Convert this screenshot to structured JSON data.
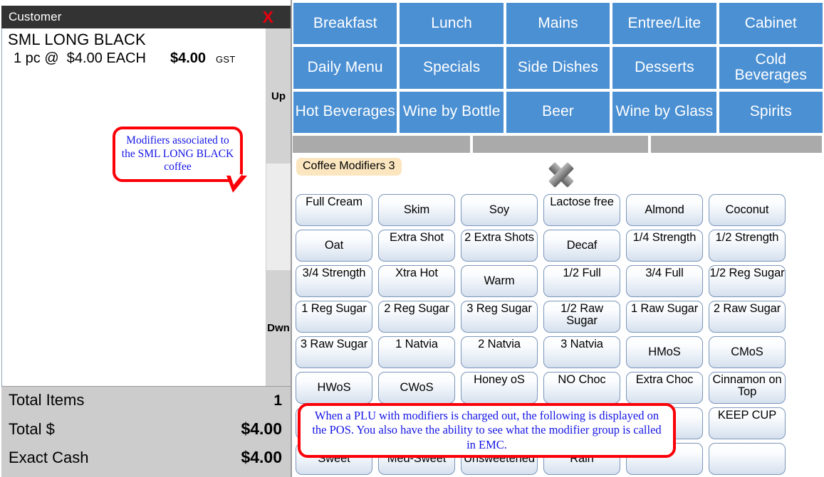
{
  "receipt": {
    "title": "Customer",
    "close_label": "X",
    "line_item": {
      "name": "SML LONG BLACK",
      "qty_text": "1 pc @  $4.00 EACH",
      "amount": "$4.00",
      "tax_code": "GST"
    },
    "scroll": {
      "up_label": "Up",
      "down_label": "Dwn"
    },
    "totals": [
      {
        "label": "Total Items",
        "value": "1"
      },
      {
        "label": "Total $",
        "value": "$4.00"
      },
      {
        "label": "Exact Cash",
        "value": "$4.00"
      }
    ]
  },
  "categories": [
    {
      "label": "Breakfast"
    },
    {
      "label": "Lunch"
    },
    {
      "label": "Mains"
    },
    {
      "label": "Entree/Lite"
    },
    {
      "label": "Cabinet"
    },
    {
      "label": "Daily Menu"
    },
    {
      "label": "Specials"
    },
    {
      "label": "Side Dishes"
    },
    {
      "label": "Desserts"
    },
    {
      "label": "Cold Beverages"
    },
    {
      "label": "Hot Beverages"
    },
    {
      "label": "Wine by Bottle"
    },
    {
      "label": "Beer"
    },
    {
      "label": "Wine by Glass"
    },
    {
      "label": "Spirits"
    }
  ],
  "modifier_group": {
    "tab_label": "Coffee Modifiers 3",
    "close_icon": "close-x-icon"
  },
  "modifiers": [
    {
      "label": "Full Cream"
    },
    {
      "label": "Skim"
    },
    {
      "label": "Soy"
    },
    {
      "label": "Lactose free"
    },
    {
      "label": "Almond"
    },
    {
      "label": "Coconut"
    },
    {
      "label": "Oat"
    },
    {
      "label": "Extra Shot"
    },
    {
      "label": "2 Extra Shots"
    },
    {
      "label": "Decaf"
    },
    {
      "label": "1/4 Strength"
    },
    {
      "label": "1/2 Strength"
    },
    {
      "label": "3/4 Strength"
    },
    {
      "label": "Xtra Hot"
    },
    {
      "label": "Warm"
    },
    {
      "label": "1/2 Full"
    },
    {
      "label": "3/4 Full"
    },
    {
      "label": "1/2 Reg Sugar"
    },
    {
      "label": "1 Reg Sugar"
    },
    {
      "label": "2 Reg Sugar"
    },
    {
      "label": "3 Reg Sugar"
    },
    {
      "label": "1/2 Raw Sugar"
    },
    {
      "label": "1 Raw Sugar"
    },
    {
      "label": "2 Raw Sugar"
    },
    {
      "label": "3 Raw Sugar"
    },
    {
      "label": "1 Natvia"
    },
    {
      "label": "2 Natvia"
    },
    {
      "label": "3 Natvia"
    },
    {
      "label": "HMoS"
    },
    {
      "label": "CMoS"
    },
    {
      "label": "HWoS"
    },
    {
      "label": "CWoS"
    },
    {
      "label": "Honey oS"
    },
    {
      "label": "NO Choc"
    },
    {
      "label": "Extra Choc"
    },
    {
      "label": "Cinnamon on Top"
    },
    {
      "label": ""
    },
    {
      "label": ""
    },
    {
      "label": ""
    },
    {
      "label": ""
    },
    {
      "label": ""
    },
    {
      "label": "KEEP CUP"
    },
    {
      "label": "Sweet"
    },
    {
      "label": "Med-Sweet"
    },
    {
      "label": "Unsweetened"
    },
    {
      "label": "Rain"
    },
    {
      "label": ""
    },
    {
      "label": ""
    }
  ],
  "annotations": {
    "left": "Modifiers associated to the SML LONG BLACK coffee",
    "bottom": "When a PLU with modifiers is charged out, the following is displayed on the POS.  You also have the ability to see what the modifier group is called in EMC."
  },
  "colors": {
    "category_blue": "#4b90d3",
    "titlebar_dark": "#333333",
    "close_red": "#e8000d",
    "annotation_red": "#fb0007",
    "annotation_blue": "#1414e6",
    "totals_gray": "#cccccc",
    "group_tab_cream": "#fbe6c0"
  }
}
